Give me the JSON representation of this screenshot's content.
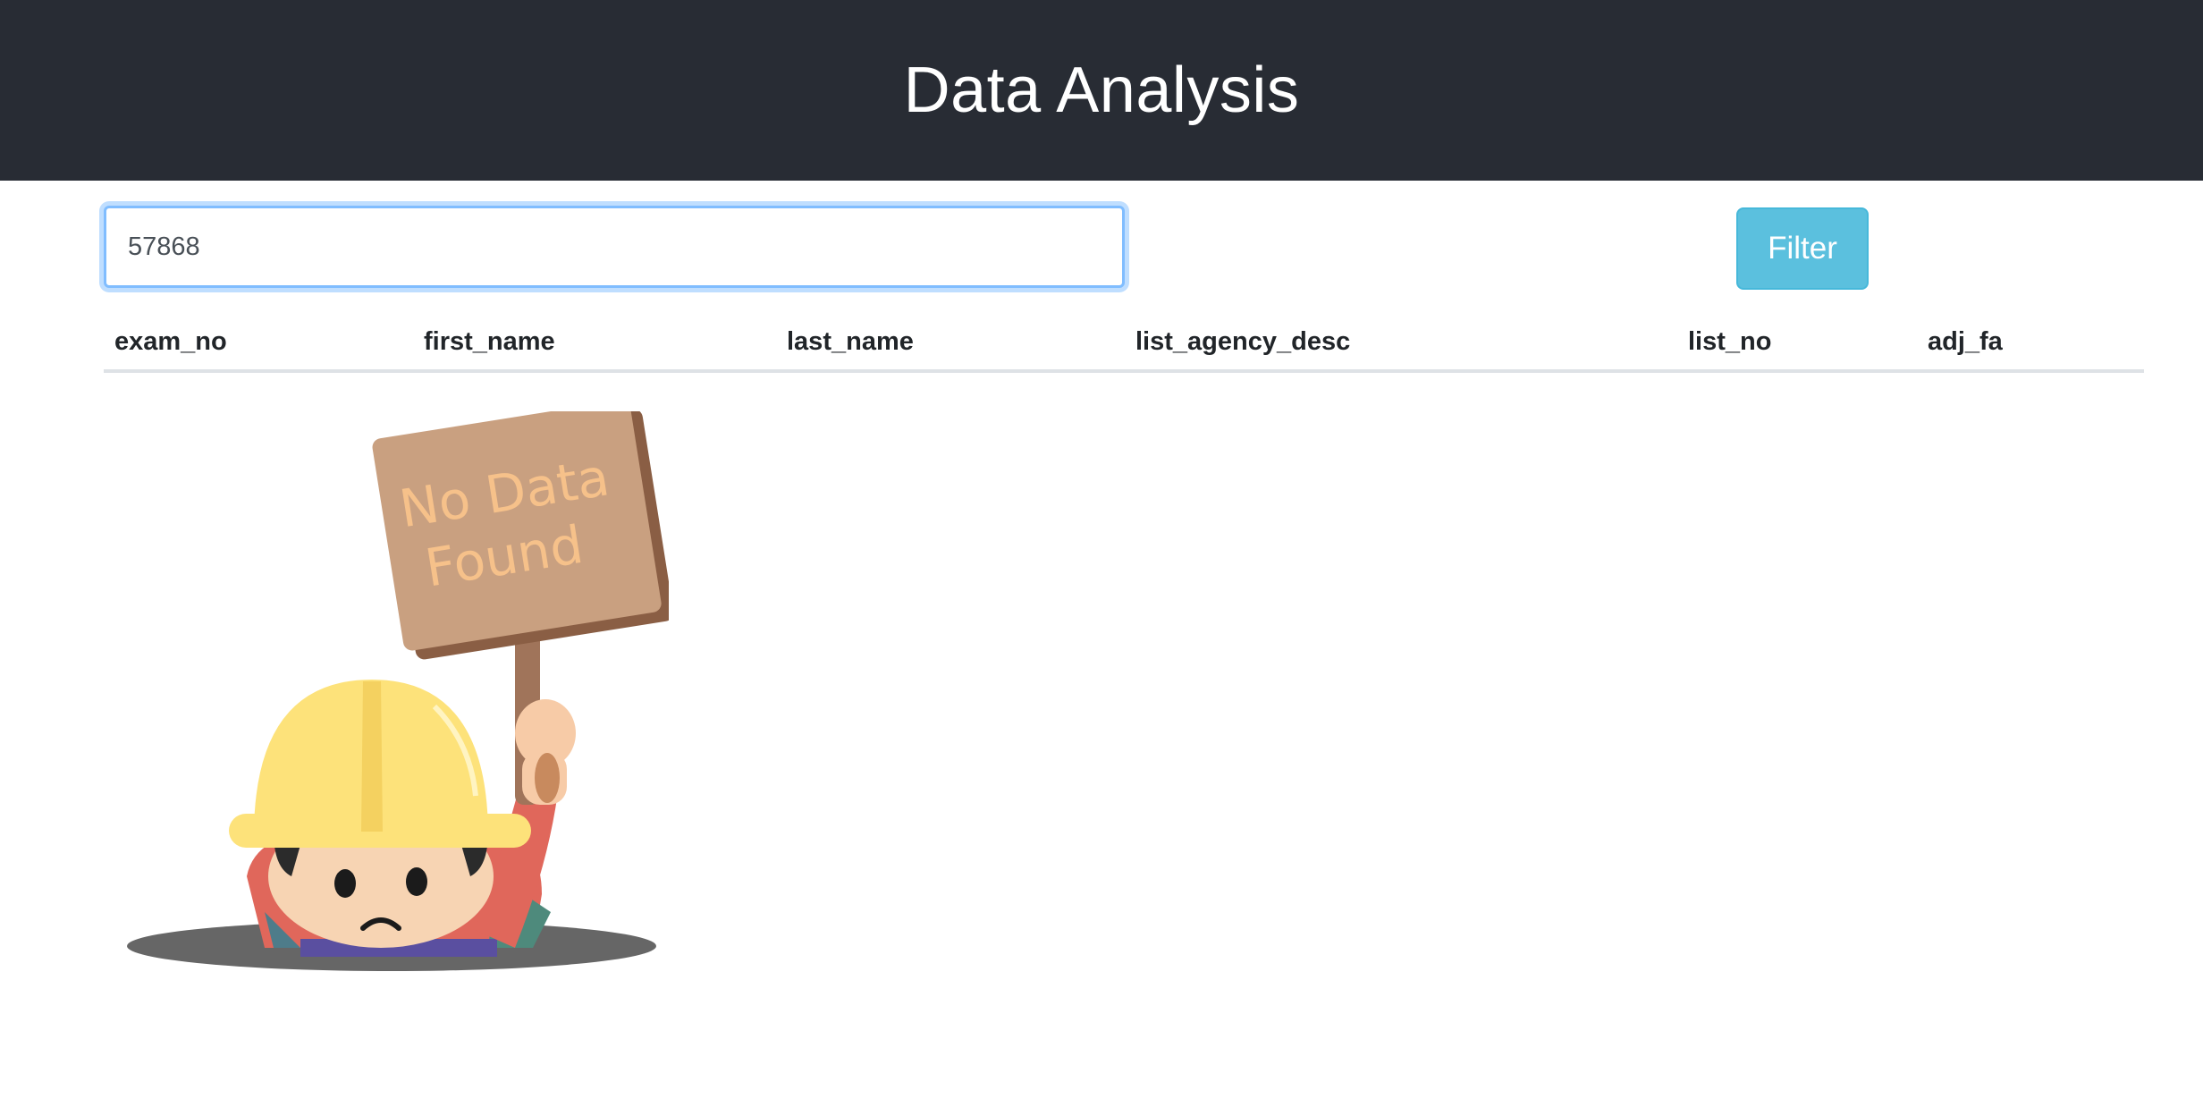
{
  "header": {
    "title": "Data Analysis"
  },
  "search": {
    "value": "57868"
  },
  "filter": {
    "label": "Filter"
  },
  "table": {
    "columns": [
      "exam_no",
      "first_name",
      "last_name",
      "list_agency_desc",
      "list_no",
      "adj_fa"
    ]
  },
  "empty_state": {
    "sign_line1": "No Data",
    "sign_line2": "Found"
  },
  "colors": {
    "header_bg": "#282c34",
    "filter_button": "#5bc0de",
    "focus_border": "#80bdff"
  }
}
